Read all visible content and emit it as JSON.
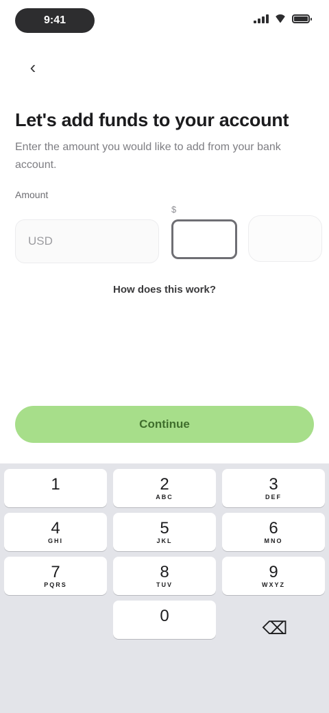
{
  "status_bar": {
    "time": "9:41",
    "icons": [
      "signal-icon",
      "wifi-icon",
      "battery-icon"
    ]
  },
  "navigation": {
    "back_icon": "chevron-left-icon",
    "back_glyph": "‹"
  },
  "header": {
    "title": "Let's add funds to your account",
    "subtitle": "Enter the amount you would like to add from your bank account."
  },
  "form": {
    "label": "Amount",
    "currency_field": "USD",
    "amount_caption": "$",
    "amount_value": "",
    "secondary_caption": "",
    "help_link": "How does this work?"
  },
  "primary_action": {
    "label": "Continue",
    "color": "#a7de8a"
  },
  "keypad": {
    "keys": [
      {
        "digit": "1",
        "letters": ""
      },
      {
        "digit": "2",
        "letters": "ABC"
      },
      {
        "digit": "3",
        "letters": "DEF"
      },
      {
        "digit": "4",
        "letters": "GHI"
      },
      {
        "digit": "5",
        "letters": "JKL"
      },
      {
        "digit": "6",
        "letters": "MNO"
      },
      {
        "digit": "7",
        "letters": "PQRS"
      },
      {
        "digit": "8",
        "letters": "TUV"
      },
      {
        "digit": "9",
        "letters": "WXYZ"
      },
      {
        "digit": "0",
        "letters": ""
      }
    ],
    "delete_icon": "backspace-icon",
    "delete_glyph": "⌫"
  },
  "colors": {
    "accent": "#a7de8a",
    "keypad_bg": "#e3e4e9"
  }
}
